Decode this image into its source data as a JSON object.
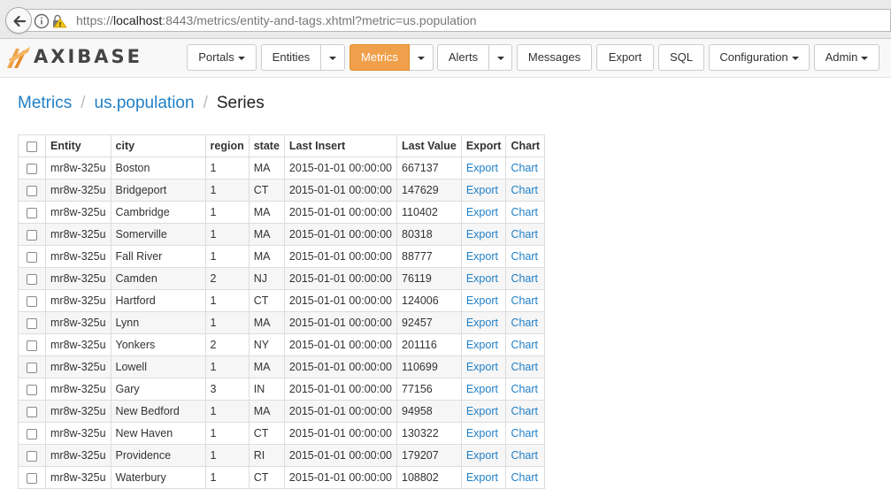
{
  "browser": {
    "url_scheme": "https://",
    "url_host": "localhost",
    "url_rest": ":8443/metrics/entity-and-tags.xhtml?metric=us.population"
  },
  "app": {
    "logo_text": "AXIBASE",
    "brand_color": "#f0a04b",
    "link_color": "#1f7fc7"
  },
  "nav": {
    "portals": "Portals",
    "entities": "Entities",
    "metrics": "Metrics",
    "alerts": "Alerts",
    "messages": "Messages",
    "export": "Export",
    "sql": "SQL",
    "configuration": "Configuration",
    "admin": "Admin"
  },
  "breadcrumb": {
    "root": "Metrics",
    "metric": "us.population",
    "current": "Series",
    "separator": "/"
  },
  "table": {
    "columns": [
      "Entity",
      "city",
      "region",
      "state",
      "Last Insert",
      "Last Value",
      "Export",
      "Chart"
    ],
    "rows": [
      {
        "entity": "mr8w-325u",
        "city": "Boston",
        "region": "1",
        "state": "MA",
        "last_insert": "2015-01-01 00:00:00",
        "last_value": "667137",
        "export": "Export",
        "chart": "Chart"
      },
      {
        "entity": "mr8w-325u",
        "city": "Bridgeport",
        "region": "1",
        "state": "CT",
        "last_insert": "2015-01-01 00:00:00",
        "last_value": "147629",
        "export": "Export",
        "chart": "Chart"
      },
      {
        "entity": "mr8w-325u",
        "city": "Cambridge",
        "region": "1",
        "state": "MA",
        "last_insert": "2015-01-01 00:00:00",
        "last_value": "110402",
        "export": "Export",
        "chart": "Chart"
      },
      {
        "entity": "mr8w-325u",
        "city": "Somerville",
        "region": "1",
        "state": "MA",
        "last_insert": "2015-01-01 00:00:00",
        "last_value": "80318",
        "export": "Export",
        "chart": "Chart"
      },
      {
        "entity": "mr8w-325u",
        "city": "Fall River",
        "region": "1",
        "state": "MA",
        "last_insert": "2015-01-01 00:00:00",
        "last_value": "88777",
        "export": "Export",
        "chart": "Chart"
      },
      {
        "entity": "mr8w-325u",
        "city": "Camden",
        "region": "2",
        "state": "NJ",
        "last_insert": "2015-01-01 00:00:00",
        "last_value": "76119",
        "export": "Export",
        "chart": "Chart"
      },
      {
        "entity": "mr8w-325u",
        "city": "Hartford",
        "region": "1",
        "state": "CT",
        "last_insert": "2015-01-01 00:00:00",
        "last_value": "124006",
        "export": "Export",
        "chart": "Chart"
      },
      {
        "entity": "mr8w-325u",
        "city": "Lynn",
        "region": "1",
        "state": "MA",
        "last_insert": "2015-01-01 00:00:00",
        "last_value": "92457",
        "export": "Export",
        "chart": "Chart"
      },
      {
        "entity": "mr8w-325u",
        "city": "Yonkers",
        "region": "2",
        "state": "NY",
        "last_insert": "2015-01-01 00:00:00",
        "last_value": "201116",
        "export": "Export",
        "chart": "Chart"
      },
      {
        "entity": "mr8w-325u",
        "city": "Lowell",
        "region": "1",
        "state": "MA",
        "last_insert": "2015-01-01 00:00:00",
        "last_value": "110699",
        "export": "Export",
        "chart": "Chart"
      },
      {
        "entity": "mr8w-325u",
        "city": "Gary",
        "region": "3",
        "state": "IN",
        "last_insert": "2015-01-01 00:00:00",
        "last_value": "77156",
        "export": "Export",
        "chart": "Chart"
      },
      {
        "entity": "mr8w-325u",
        "city": "New Bedford",
        "region": "1",
        "state": "MA",
        "last_insert": "2015-01-01 00:00:00",
        "last_value": "94958",
        "export": "Export",
        "chart": "Chart"
      },
      {
        "entity": "mr8w-325u",
        "city": "New Haven",
        "region": "1",
        "state": "CT",
        "last_insert": "2015-01-01 00:00:00",
        "last_value": "130322",
        "export": "Export",
        "chart": "Chart"
      },
      {
        "entity": "mr8w-325u",
        "city": "Providence",
        "region": "1",
        "state": "RI",
        "last_insert": "2015-01-01 00:00:00",
        "last_value": "179207",
        "export": "Export",
        "chart": "Chart"
      },
      {
        "entity": "mr8w-325u",
        "city": "Waterbury",
        "region": "1",
        "state": "CT",
        "last_insert": "2015-01-01 00:00:00",
        "last_value": "108802",
        "export": "Export",
        "chart": "Chart"
      }
    ]
  }
}
